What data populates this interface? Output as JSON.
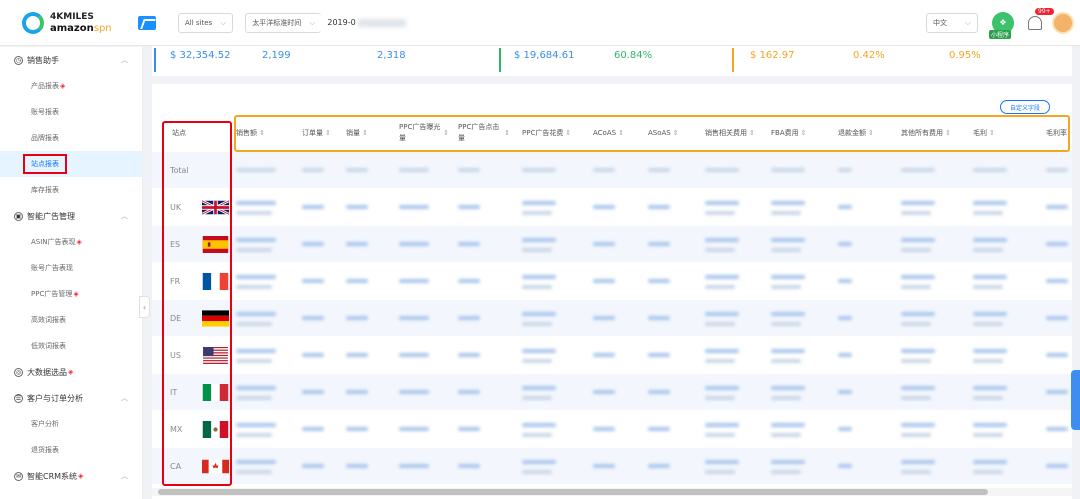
{
  "brand": {
    "line1": "4KMILES",
    "line2": "amazon",
    "line2_suffix": "spn"
  },
  "topbar": {
    "site_select": "All sites",
    "timezone_select": "太平洋标准时间",
    "date_value": "2019-0",
    "language": "中文",
    "mini_app_label": "小程序",
    "notifications": "99+"
  },
  "sidebar": {
    "groups": [
      {
        "label": "销售助手",
        "items": [
          "产品报表",
          "账号报表",
          "品牌报表",
          "站点报表",
          "库存报表"
        ],
        "hot": [
          true,
          false,
          false,
          false,
          false
        ]
      },
      {
        "label": "智能广告管理",
        "items": [
          "ASIN广告表现",
          "账号广告表现",
          "PPC广告管理",
          "高效词报表",
          "低效词报表"
        ],
        "hot": [
          true,
          false,
          true,
          false,
          false
        ]
      },
      {
        "label": "大数据选品",
        "items": [],
        "hot": []
      },
      {
        "label": "客户与订单分析",
        "items": [
          "客户分析",
          "退货报表"
        ],
        "hot": [
          false,
          false
        ]
      },
      {
        "label": "智能CRM系统",
        "items": [],
        "hot": []
      }
    ],
    "active_item": "站点报表",
    "hot_mark": "◈"
  },
  "summary": {
    "values": [
      "$ 32,354.52",
      "2,199",
      "2,318",
      "$ 19,684.61",
      "60.84%",
      "$ 162.97",
      "0.42%",
      "0.95%"
    ],
    "colors": {
      "accent_green": "#2fb56a",
      "accent_orange": "#f5a623",
      "value_blue": "#3a8ee6"
    }
  },
  "table": {
    "custom_fields_button": "自定义字段",
    "site_header": "站点",
    "columns": [
      "销售额",
      "订单量",
      "销量",
      "PPC广告曝光量",
      "PPC广告点击量",
      "PPC广告花费",
      "ACoAS",
      "ASoAS",
      "销售相关费用",
      "FBA费用",
      "退款金额",
      "其他所有费用",
      "毛利",
      "毛利率"
    ],
    "sort_icon": "⇕",
    "rows": [
      {
        "site": "Total",
        "flag": "none"
      },
      {
        "site": "UK",
        "flag": "uk"
      },
      {
        "site": "ES",
        "flag": "es"
      },
      {
        "site": "FR",
        "flag": "fr"
      },
      {
        "site": "DE",
        "flag": "de"
      },
      {
        "site": "US",
        "flag": "us"
      },
      {
        "site": "IT",
        "flag": "it"
      },
      {
        "site": "MX",
        "flag": "mx"
      },
      {
        "site": "CA",
        "flag": "ca"
      }
    ]
  }
}
